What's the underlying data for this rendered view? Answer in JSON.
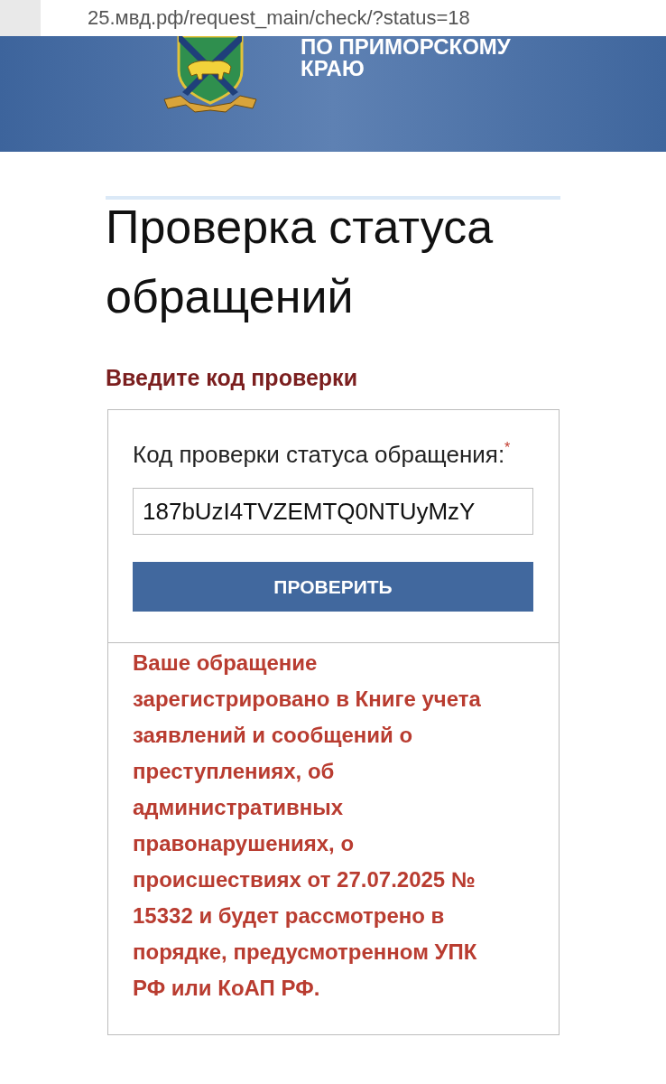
{
  "browser": {
    "url": "25.мвд.рф/request_main/check/?status=18"
  },
  "header": {
    "title_lines": [
      "ПО ПРИМОРСКОМУ",
      "КРАЮ"
    ]
  },
  "page": {
    "title": "Проверка статуса обращений",
    "subtitle": "Введите код проверки"
  },
  "form": {
    "field": {
      "label": "Код проверки статуса обращения:",
      "required_mark": "*",
      "value": "187bUzI4TVZEMTQ0NTUyMzY"
    },
    "submit": "ПРОВЕРИТЬ",
    "result": "Ваше обращение зарегистрировано в Книге учета заявлений и сообщений о преступлениях, об административных правонарушениях, о происшествиях от 27.07.2025 № 15332 и будет рассмотрено в порядке, предусмотренном УПК РФ или КоАП РФ."
  }
}
